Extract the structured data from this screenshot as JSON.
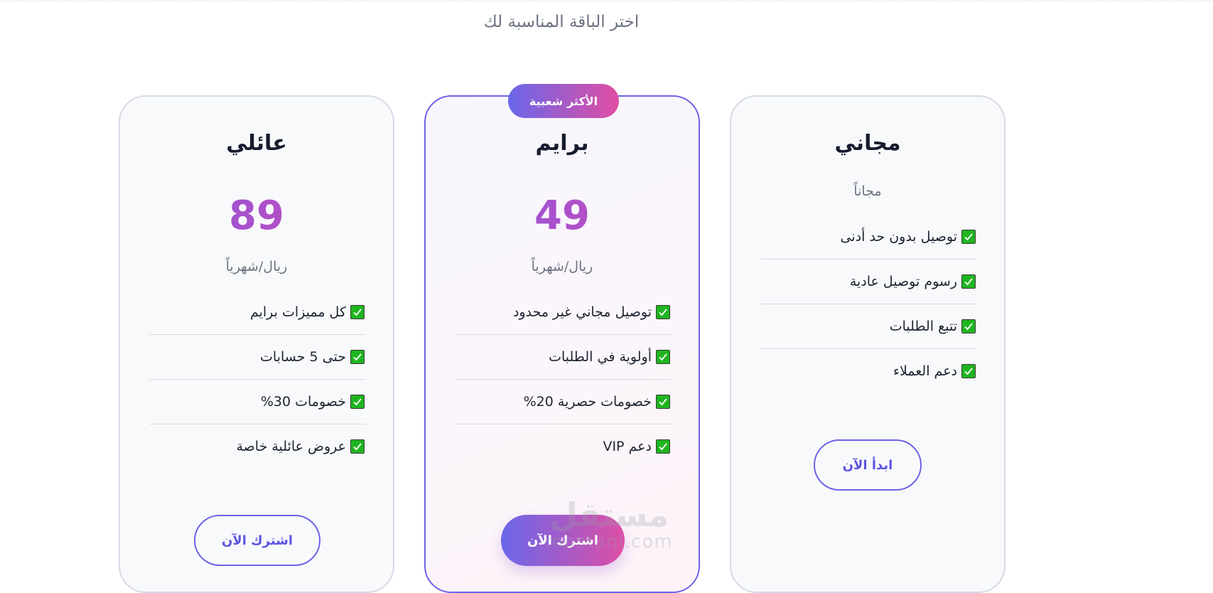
{
  "subtitle": "اختر الباقة المناسبة لك",
  "plans": {
    "free": {
      "name": "مجاني",
      "price_text": "مجاناً",
      "features": [
        "توصيل بدون حد أدنى",
        "رسوم توصيل عادية",
        "تتبع الطلبات",
        "دعم العملاء"
      ],
      "button": "ابدأ الآن"
    },
    "prime": {
      "badge": "الأكثر شعبية",
      "name": "برايم",
      "price": "49",
      "unit": "ريال/شهرياً",
      "features": [
        "توصيل مجاني غير محدود",
        "أولوية في الطلبات",
        "خصومات حصرية 20%",
        "دعم VIP"
      ],
      "button": "اشترك الآن"
    },
    "family": {
      "name": "عائلي",
      "price": "89",
      "unit": "ريال/شهرياً",
      "features": [
        "كل مميزات برايم",
        "حتى 5 حسابات",
        "خصومات 30%",
        "عروض عائلية خاصة"
      ],
      "button": "اشترك الآن"
    }
  },
  "watermark": {
    "arabic": "مستقل",
    "latin": "mostaql.com"
  },
  "colors": {
    "accent_start": "#6a67ea",
    "accent_end": "#e04ea3",
    "check_green": "#1fb51f",
    "card_border": "#d6dae6",
    "featured_border": "#6e63e6"
  },
  "icons": {
    "feature_check": "check-mark-icon"
  }
}
